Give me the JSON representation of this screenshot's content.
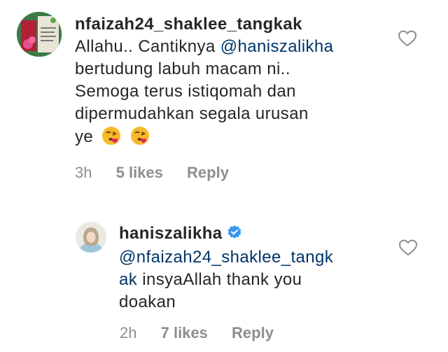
{
  "comments": [
    {
      "username": "nfaizah24_shaklee_tangkak",
      "text_lines": [
        "Allahu.. Cantiknya ",
        "bertudung labuh macam ni..",
        "Semoga terus istiqomah dan",
        "dipermudahkan segala urusan",
        "ye"
      ],
      "mention": "@haniszalikha",
      "emojis": [
        "kissing-heart-emoji",
        "kissing-heart-emoji"
      ],
      "time": "3h",
      "likes": "5 likes",
      "reply_label": "Reply",
      "verified": false
    },
    {
      "username": "haniszalikha",
      "mention_line_1": "@nfaizah24_shaklee_tangk",
      "mention_line_2": "ak",
      "text_rest_line_2": " insyaAllah thank you",
      "text_line_3": "doakan",
      "time": "2h",
      "likes": "7 likes",
      "reply_label": "Reply",
      "verified": true
    }
  ],
  "colors": {
    "text": "#262626",
    "mention": "#003569",
    "meta": "#8e8e8e",
    "verified": "#3897f0"
  }
}
